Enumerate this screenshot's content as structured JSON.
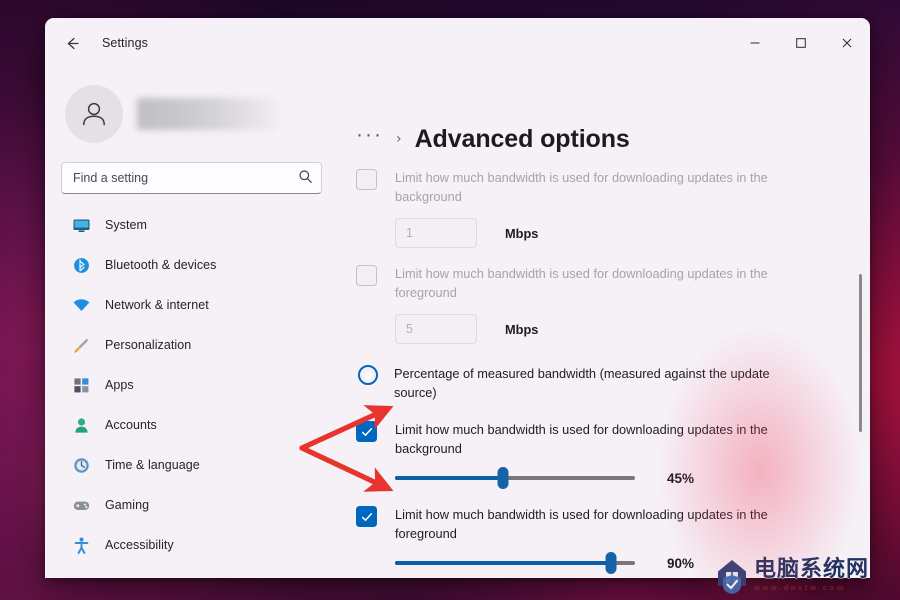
{
  "window": {
    "title": "Settings",
    "back_icon": "back-arrow-icon",
    "controls": {
      "minimize": "—",
      "maximize": "□",
      "close": "✕"
    }
  },
  "sidebar": {
    "account": {
      "avatar_icon": "person-avatar-icon",
      "name": ""
    },
    "search": {
      "placeholder": "Find a setting",
      "value": "",
      "icon": "search-icon"
    },
    "items": [
      {
        "label": "System",
        "icon": "monitor-icon"
      },
      {
        "label": "Bluetooth & devices",
        "icon": "bluetooth-icon"
      },
      {
        "label": "Network & internet",
        "icon": "wifi-icon"
      },
      {
        "label": "Personalization",
        "icon": "paintbrush-icon"
      },
      {
        "label": "Apps",
        "icon": "apps-grid-icon"
      },
      {
        "label": "Accounts",
        "icon": "person-icon"
      },
      {
        "label": "Time & language",
        "icon": "clock-globe-icon"
      },
      {
        "label": "Gaming",
        "icon": "gamepad-icon"
      },
      {
        "label": "Accessibility",
        "icon": "accessibility-icon"
      }
    ]
  },
  "main": {
    "breadcrumb": {
      "overflow": "···",
      "separator": "›"
    },
    "title": "Advanced options",
    "absolute_group": {
      "background": {
        "checkbox_label": "Limit how much bandwidth is used for downloading updates in the background",
        "checked": false,
        "enabled": false,
        "value": "1",
        "unit": "Mbps"
      },
      "foreground": {
        "checkbox_label": "Limit how much bandwidth is used for downloading updates in the foreground",
        "checked": false,
        "enabled": false,
        "value": "5",
        "unit": "Mbps"
      }
    },
    "percentage_option": {
      "label": "Percentage of measured bandwidth (measured against the update source)",
      "selected": true
    },
    "percentage_group": {
      "background": {
        "checkbox_label": "Limit how much bandwidth is used for downloading updates in the background",
        "checked": true,
        "percent_label": "45%",
        "percent_value": 45
      },
      "foreground": {
        "checkbox_label": "Limit how much bandwidth is used for downloading updates in the foreground",
        "checked": true,
        "percent_label": "90%",
        "percent_value": 90
      }
    },
    "checkmark_glyph": "✓"
  },
  "annotations": {
    "color": "#e8342f",
    "arrow_count": 2,
    "targets": [
      "background-percent-checkbox",
      "foreground-percent-checkbox"
    ]
  },
  "watermark": {
    "name_cn": "电脑系统网",
    "url": "www.dnxtw.com"
  },
  "colors": {
    "accent": "#0067c0",
    "slider_fill": "#0a5fa8",
    "window_bg": "#f6f0f7",
    "annotation_red": "#e8342f"
  }
}
